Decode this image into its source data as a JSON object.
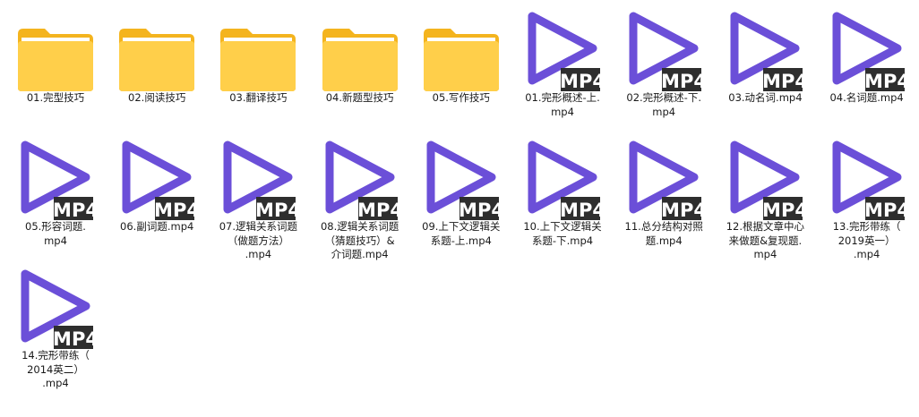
{
  "colors": {
    "folder_back": "#f4b41e",
    "folder_front": "#ffcf4a",
    "folder_paper": "#ffffff",
    "play": "#6b4fd8",
    "badge": "#2e2e2e",
    "badge_text": "#ffffff",
    "label_text": "#1a1a1a"
  },
  "items": [
    {
      "type": "folder",
      "icon": "folder-icon",
      "label": "01.完型技巧"
    },
    {
      "type": "folder",
      "icon": "folder-icon",
      "label": "02.阅读技巧"
    },
    {
      "type": "folder",
      "icon": "folder-icon",
      "label": "03.翻译技巧"
    },
    {
      "type": "folder",
      "icon": "folder-icon",
      "label": "04.新题型技巧"
    },
    {
      "type": "folder",
      "icon": "folder-icon",
      "label": "05.写作技巧"
    },
    {
      "type": "video",
      "icon": "video-file-icon",
      "badge": "MP4",
      "label": "01.完形概述-上.\nmp4"
    },
    {
      "type": "video",
      "icon": "video-file-icon",
      "badge": "MP4",
      "label": "02.完形概述-下.\nmp4"
    },
    {
      "type": "video",
      "icon": "video-file-icon",
      "badge": "MP4",
      "label": "03.动名词.mp4"
    },
    {
      "type": "video",
      "icon": "video-file-icon",
      "badge": "MP4",
      "label": "04.名词题.mp4"
    },
    {
      "type": "video",
      "icon": "video-file-icon",
      "badge": "MP4",
      "label": "05.形容词题.\nmp4"
    },
    {
      "type": "video",
      "icon": "video-file-icon",
      "badge": "MP4",
      "label": "06.副词题.mp4"
    },
    {
      "type": "video",
      "icon": "video-file-icon",
      "badge": "MP4",
      "label": "07.逻辑关系词题\n（做题方法）\n.mp4"
    },
    {
      "type": "video",
      "icon": "video-file-icon",
      "badge": "MP4",
      "label": "08.逻辑关系词题\n（猜题技巧）&\n介词题.mp4"
    },
    {
      "type": "video",
      "icon": "video-file-icon",
      "badge": "MP4",
      "label": "09.上下文逻辑关\n系题-上.mp4"
    },
    {
      "type": "video",
      "icon": "video-file-icon",
      "badge": "MP4",
      "label": "10.上下文逻辑关\n系题-下.mp4"
    },
    {
      "type": "video",
      "icon": "video-file-icon",
      "badge": "MP4",
      "label": "11.总分结构对照\n题.mp4"
    },
    {
      "type": "video",
      "icon": "video-file-icon",
      "badge": "MP4",
      "label": "12.根据文章中心\n来做题&复现题.\nmp4"
    },
    {
      "type": "video",
      "icon": "video-file-icon",
      "badge": "MP4",
      "label": "13.完形带练（\n2019英一）\n.mp4"
    },
    {
      "type": "video",
      "icon": "video-file-icon",
      "badge": "MP4",
      "label": "14.完形带练（\n2014英二）\n.mp4"
    }
  ]
}
